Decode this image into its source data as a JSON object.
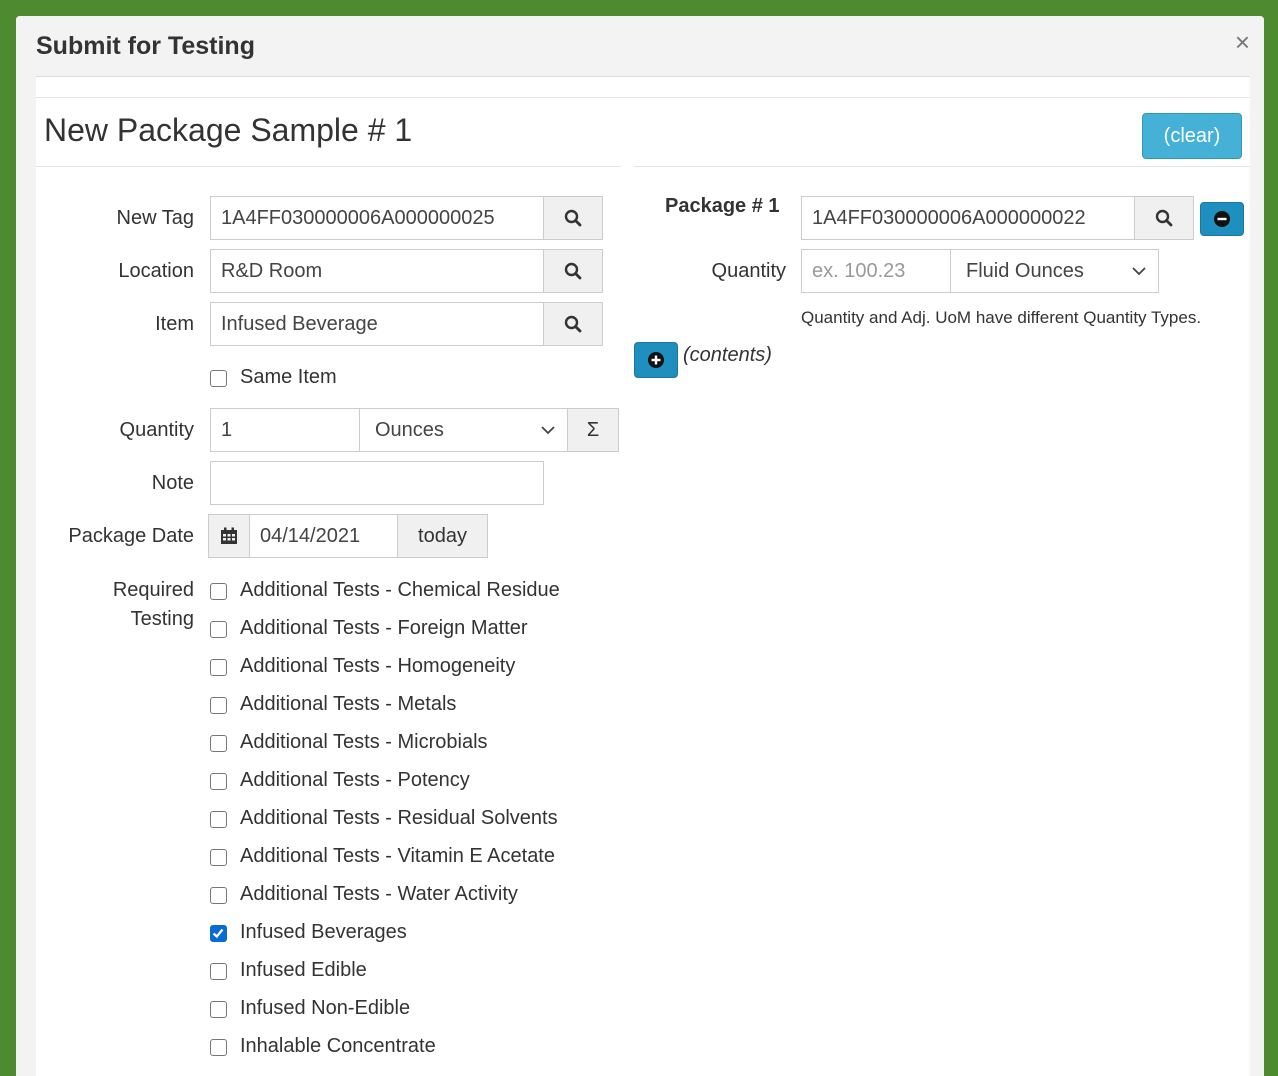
{
  "dialog": {
    "title": "Submit for Testing",
    "close": "×"
  },
  "sample": {
    "title": "New Package Sample # 1",
    "clear_label": "(clear)"
  },
  "fields": {
    "new_tag": {
      "label": "New Tag",
      "value": "1A4FF030000006A000000025"
    },
    "location": {
      "label": "Location",
      "value": "R&D Room"
    },
    "item": {
      "label": "Item",
      "value": "Infused Beverage"
    },
    "same_item": {
      "label": "Same Item",
      "checked": false
    },
    "quantity": {
      "label": "Quantity",
      "value": "1",
      "unit": "Ounces",
      "sum_label": "Σ"
    },
    "note": {
      "label": "Note",
      "value": ""
    },
    "package_date": {
      "label": "Package Date",
      "value": "04/14/2021",
      "today_label": "today"
    }
  },
  "required_testing": {
    "label_line1": "Required",
    "label_line2": "Testing",
    "options": [
      {
        "label": "Additional Tests - Chemical Residue",
        "checked": false
      },
      {
        "label": "Additional Tests - Foreign Matter",
        "checked": false
      },
      {
        "label": "Additional Tests - Homogeneity",
        "checked": false
      },
      {
        "label": "Additional Tests - Metals",
        "checked": false
      },
      {
        "label": "Additional Tests - Microbials",
        "checked": false
      },
      {
        "label": "Additional Tests - Potency",
        "checked": false
      },
      {
        "label": "Additional Tests - Residual Solvents",
        "checked": false
      },
      {
        "label": "Additional Tests - Vitamin E Acetate",
        "checked": false
      },
      {
        "label": "Additional Tests - Water Activity",
        "checked": false
      },
      {
        "label": "Infused Beverages",
        "checked": true
      },
      {
        "label": "Infused Edible",
        "checked": false
      },
      {
        "label": "Infused Non-Edible",
        "checked": false
      },
      {
        "label": "Inhalable Concentrate",
        "checked": false
      }
    ]
  },
  "package": {
    "label": "Package # 1",
    "value": "1A4FF030000006A000000022",
    "quantity_label": "Quantity",
    "quantity_placeholder": "ex. 100.23",
    "unit": "Fluid Ounces",
    "help_text": "Quantity and Adj. UoM have different Quantity Types.",
    "contents_label": "(contents)"
  },
  "colors": {
    "accent": "#46b1d6",
    "dark_accent": "#1f8fbf",
    "frame": "#4e8a2f",
    "checkbox": "#0a6ad6"
  }
}
